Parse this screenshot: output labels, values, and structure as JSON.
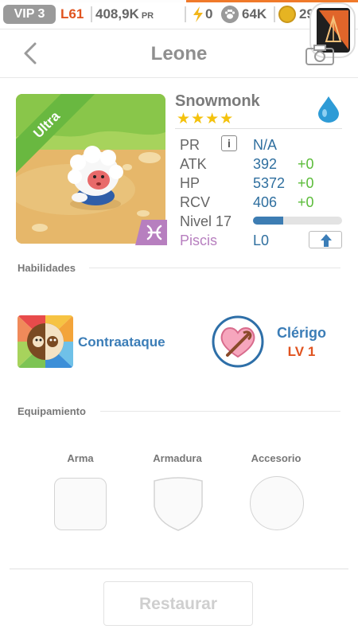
{
  "status_bar": {
    "vip": "VIP 3",
    "level": "L61",
    "power": "408,9K",
    "power_unit": "PR",
    "energy": "0",
    "food": "64K",
    "gold": "29",
    "icons": [
      "bolt-icon",
      "paw-icon",
      "coin-icon",
      "app-badge-icon"
    ]
  },
  "header": {
    "title": "Leone"
  },
  "pet": {
    "name": "Snowmonk",
    "rarity_label": "Ultra",
    "stars": "★★★★",
    "star_count": 4,
    "element": "water-drop",
    "stats": {
      "pr_label": "PR",
      "pr_value": "N/A",
      "atk_label": "ATK",
      "atk_value": "392",
      "atk_bonus": "+0",
      "hp_label": "HP",
      "hp_value": "5372",
      "hp_bonus": "+0",
      "rcv_label": "RCV",
      "rcv_value": "406",
      "rcv_bonus": "+0",
      "level_label": "Nivel 17",
      "level_progress": 0.34,
      "zodiac_label": "Piscis",
      "zodiac_value": "L0"
    }
  },
  "abilities": {
    "section_title": "Habilidades",
    "active_name": "Contraataque",
    "leader_name": "Clérigo",
    "leader_level": "LV 1"
  },
  "equipment": {
    "section_title": "Equipamiento",
    "weapon": "Arma",
    "armor": "Armadura",
    "accessory": "Accesorio"
  },
  "footer": {
    "restore": "Restaurar"
  },
  "colors": {
    "accent_blue": "#3b7db7",
    "accent_orange": "#e0531f",
    "bonus_green": "#5bbc3a",
    "zodiac_purple": "#b77fbf",
    "star_yellow": "#f4c20d"
  }
}
